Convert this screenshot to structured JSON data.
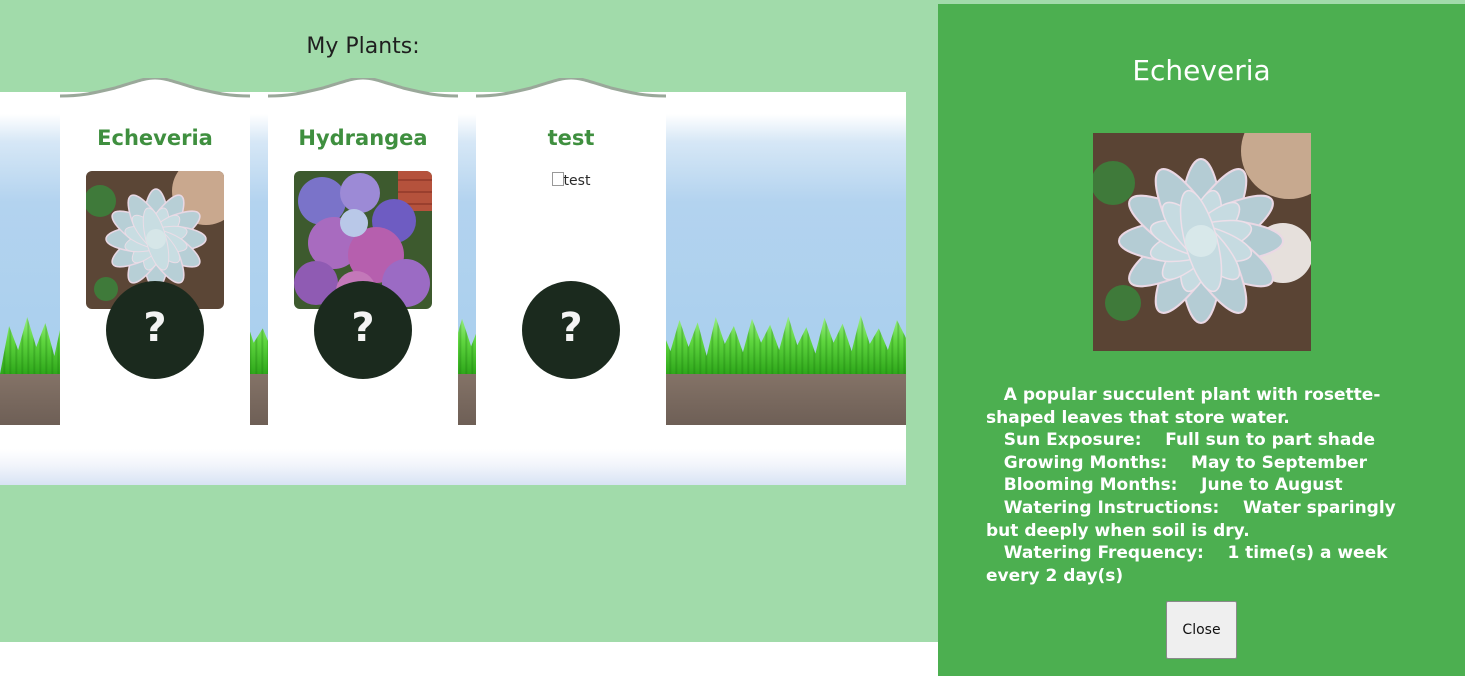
{
  "heading": "My Plants:",
  "plants": [
    {
      "name": "Echeveria",
      "badge": "?"
    },
    {
      "name": "Hydrangea",
      "badge": "?"
    },
    {
      "name": "test",
      "image_alt": "test",
      "badge": "?"
    }
  ],
  "detail": {
    "title": "Echeveria",
    "description": "A popular succulent plant with rosette-shaped leaves that store water.",
    "fields": [
      {
        "label": "Sun Exposure:",
        "value": "Full sun to part shade"
      },
      {
        "label": "Growing Months:",
        "value": "May to September"
      },
      {
        "label": "Blooming Months:",
        "value": "June to August"
      },
      {
        "label": "Watering Instructions:",
        "value": "Water sparingly but deeply when soil is dry."
      },
      {
        "label": "Watering Frequency:",
        "value": "1 time(s) a week every 2 day(s)"
      }
    ],
    "close_label": "Close"
  },
  "colors": {
    "page_background": "#a1dbaa",
    "panel_background": "#4caf50",
    "plant_name": "#3f8f3f",
    "badge": "#1b2a1e"
  },
  "icons": [
    "question-mark-icon"
  ]
}
